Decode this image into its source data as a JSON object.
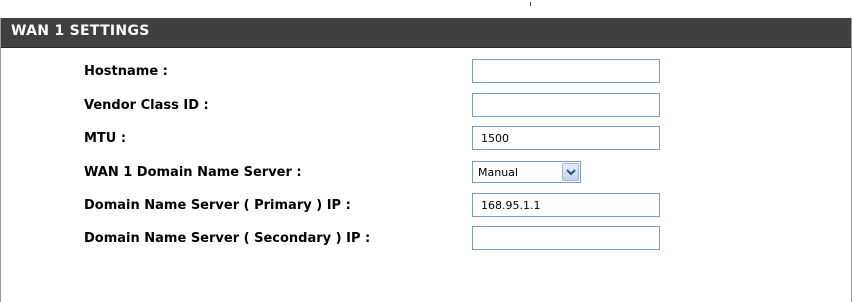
{
  "section": {
    "title": "WAN 1 SETTINGS"
  },
  "fields": {
    "hostname": {
      "label": "Hostname  :",
      "value": ""
    },
    "vendor_class_id": {
      "label": "Vendor Class ID :",
      "value": ""
    },
    "mtu": {
      "label": "MTU :",
      "value": "1500"
    },
    "dns_mode": {
      "label": "WAN 1 Domain Name Server :",
      "selected": "Manual"
    },
    "dns_primary": {
      "label": "Domain Name Server ( Primary ) IP :",
      "value": "168.95.1.1"
    },
    "dns_secondary": {
      "label": "Domain Name Server ( Secondary ) IP :",
      "value": ""
    }
  },
  "icons": {
    "dropdown": "chevron-down-icon"
  },
  "colors": {
    "header_bg": "#404040",
    "header_text": "#ffffff",
    "input_border": "#7a9cc4"
  }
}
